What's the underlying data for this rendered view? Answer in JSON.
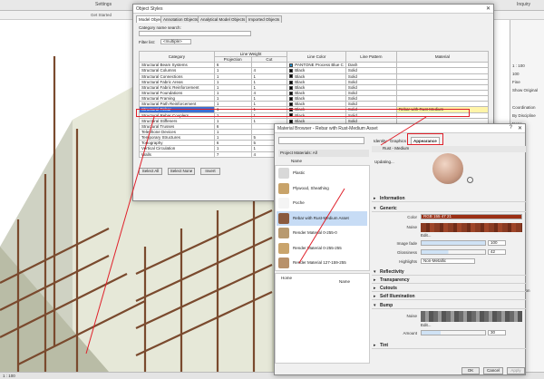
{
  "ribbon": {
    "settings": "Settings",
    "inquiry": "Inquiry",
    "get_started": "Get Started"
  },
  "status": {
    "scale": "1 : 100"
  },
  "props_panel": [
    "1 : 100",
    "100",
    "Fine",
    "Show Original",
    "Coordination",
    "By Discipline",
    "None",
    "raphic",
    "e",
    "nstruction"
  ],
  "object_styles": {
    "title": "Object Styles",
    "tabs": [
      "Model Objects",
      "Annotation Objects",
      "Analytical Model Objects",
      "Imported Objects"
    ],
    "search_label": "Category name search:",
    "filter_label": "Filter list:",
    "filter_value": "<multiple>",
    "headers": {
      "category": "Category",
      "line_weight": "Line Weight",
      "projection": "Projection",
      "cut": "Cut",
      "line_color": "Line Color",
      "line_pattern": "Line Pattern",
      "material": "Material"
    },
    "rows": [
      {
        "name": "Structural Beam Systems",
        "proj": "6",
        "cut": "",
        "color": "PANTONE Process Blue C",
        "pattern": "Dash",
        "material": "",
        "swatch": "#1e90d0"
      },
      {
        "name": "Structural Columns",
        "proj": "1",
        "cut": "4",
        "color": "Black",
        "pattern": "Solid",
        "material": "",
        "swatch": "#000000"
      },
      {
        "name": "Structural Connections",
        "proj": "1",
        "cut": "1",
        "color": "Black",
        "pattern": "Solid",
        "material": "",
        "swatch": "#000000"
      },
      {
        "name": "Structural Fabric Areas",
        "proj": "1",
        "cut": "1",
        "color": "Black",
        "pattern": "Solid",
        "material": "",
        "swatch": "#000000"
      },
      {
        "name": "Structural Fabric Reinforcement",
        "proj": "1",
        "cut": "1",
        "color": "Black",
        "pattern": "Solid",
        "material": "",
        "swatch": "#000000"
      },
      {
        "name": "Structural Foundations",
        "proj": "1",
        "cut": "4",
        "color": "Black",
        "pattern": "Solid",
        "material": "",
        "swatch": "#000000"
      },
      {
        "name": "Structural Framing",
        "proj": "1",
        "cut": "1",
        "color": "Black",
        "pattern": "Solid",
        "material": "",
        "swatch": "#000000"
      },
      {
        "name": "Structural Path Reinforcement",
        "proj": "1",
        "cut": "1",
        "color": "Black",
        "pattern": "Solid",
        "material": "",
        "swatch": "#000000"
      },
      {
        "name": "Structural Rebar",
        "proj": "1",
        "cut": "1",
        "color": "Black",
        "pattern": "Solid",
        "material": "Rebar with Rust-Medium",
        "swatch": "#000000",
        "selected": true
      },
      {
        "name": "Structural Rebar Couplers",
        "proj": "1",
        "cut": "1",
        "color": "Black",
        "pattern": "Solid",
        "material": "",
        "swatch": "#000000"
      },
      {
        "name": "Structural Stiffeners",
        "proj": "1",
        "cut": "1",
        "color": "Black",
        "pattern": "Solid",
        "material": "",
        "swatch": "#000000"
      },
      {
        "name": "Structural Trusses",
        "proj": "6",
        "cut": "",
        "color": "Black",
        "pattern": "Solid",
        "material": "",
        "swatch": "#000000"
      },
      {
        "name": "Telephone Devices",
        "proj": "1",
        "cut": "",
        "color": "Black",
        "pattern": "Solid",
        "material": "",
        "swatch": "#000000"
      },
      {
        "name": "Temporary Structures",
        "proj": "1",
        "cut": "5",
        "color": "Black",
        "pattern": "Solid",
        "material": "",
        "swatch": "#000000"
      },
      {
        "name": "Topography",
        "proj": "6",
        "cut": "5",
        "color": "Black",
        "pattern": "Solid",
        "material": "",
        "swatch": "#000000"
      },
      {
        "name": "Vertical Circulation",
        "proj": "1",
        "cut": "1",
        "color": "Black",
        "pattern": "Solid",
        "material": "",
        "swatch": "#000000"
      },
      {
        "name": "Walls",
        "proj": "7",
        "cut": "4",
        "color": "Black",
        "pattern": "Solid",
        "material": "",
        "swatch": "#000000"
      }
    ],
    "buttons": {
      "select_all": "Select All",
      "select_none": "Select None",
      "invert": "Invert"
    }
  },
  "material_browser": {
    "title": "Material Browser - Rebar with Rust-Medium Asset",
    "tabs": [
      "Identity",
      "Graphics",
      "Appearance"
    ],
    "section_header": "Project Materials: All",
    "name_col": "Name",
    "asset_name": "Rust - Medium",
    "updating": "Updating...",
    "materials": [
      {
        "name": "Plastic",
        "color": "#d8d8d8"
      },
      {
        "name": "Plywood, Sheathing",
        "color": "#c8a36a"
      },
      {
        "name": "Poche",
        "color": "#f4f4f4"
      },
      {
        "name": "Rebar with Rust-Medium Asset",
        "color": "#8a5a3e",
        "selected": true
      },
      {
        "name": "Render Material 0-255-0",
        "color": "#b89a70"
      },
      {
        "name": "Render Material 0-255-255",
        "color": "#c9a46c"
      },
      {
        "name": "Render Material 127-159-255",
        "color": "#b8916a"
      }
    ],
    "library": {
      "home": "Home",
      "name_col": "Name"
    },
    "sections": {
      "information": "Information",
      "generic": "Generic",
      "reflectivity": "Reflectivity",
      "transparency": "Transparency",
      "cutouts": "Cutouts",
      "self_illumination": "Self Illumination",
      "bump": "Bump",
      "tint": "Tint"
    },
    "generic": {
      "color_label": "Color",
      "color_value": "RGB 155 47 21",
      "color_hex": "#9b2f15",
      "noise_label": "Noise",
      "edit": "Edit...",
      "image_fade_label": "Image fade",
      "image_fade_value": "100",
      "glossiness_label": "Glossiness",
      "glossiness_value": "42",
      "highlights_label": "Highlights",
      "highlights_value": "Non-Metallic"
    },
    "bump": {
      "noise_label": "Noise",
      "edit": "Edit...",
      "amount_label": "Amount",
      "amount_value": "30"
    },
    "buttons": {
      "ok": "OK",
      "cancel": "Cancel",
      "apply": "Apply"
    }
  }
}
